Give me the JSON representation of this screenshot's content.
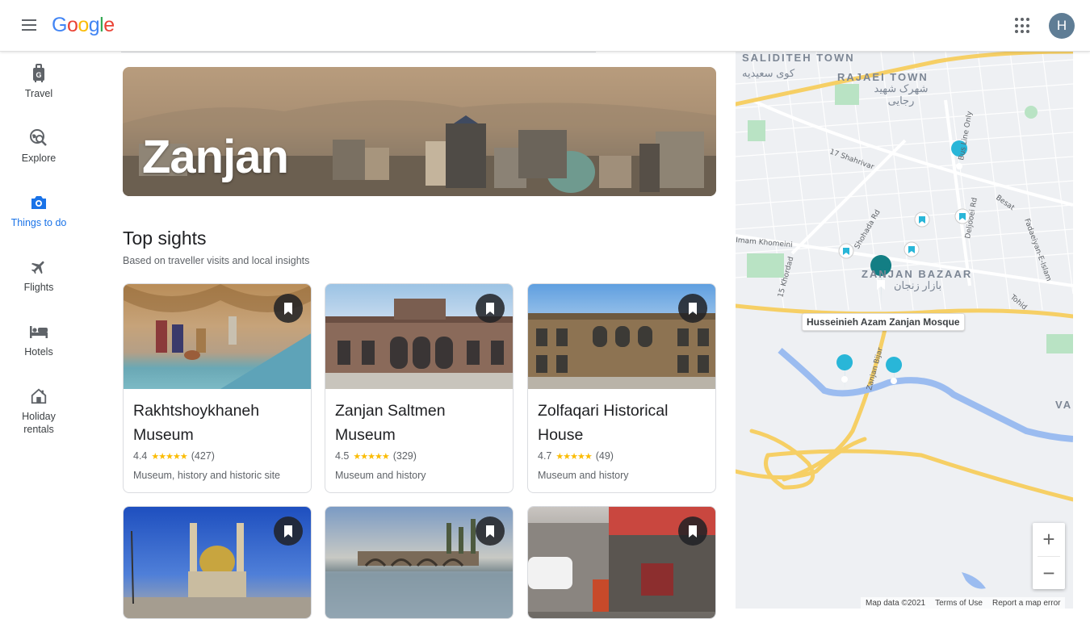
{
  "header": {
    "logo": "Google",
    "avatar_initial": "H"
  },
  "nav": [
    {
      "label": "Travel",
      "icon": "luggage-icon"
    },
    {
      "label": "Explore",
      "icon": "explore-icon"
    },
    {
      "label": "Things to do",
      "icon": "camera-icon",
      "active": true
    },
    {
      "label": "Flights",
      "icon": "plane-icon"
    },
    {
      "label": "Hotels",
      "icon": "bed-icon"
    },
    {
      "label": "Holiday rentals",
      "icon": "home-icon"
    }
  ],
  "hero": {
    "title": "Zanjan"
  },
  "section": {
    "title": "Top sights",
    "subtitle": "Based on traveller visits and local insights"
  },
  "cards": [
    {
      "name": "Rakhtshoykhaneh Museum",
      "rating": "4.4",
      "reviews": "(427)",
      "category": "Museum, history and historic site",
      "stars": 4.4
    },
    {
      "name": "Zanjan Saltmen Museum",
      "rating": "4.5",
      "reviews": "(329)",
      "category": "Museum and history",
      "stars": 4.5
    },
    {
      "name": "Zolfaqari Historical House",
      "rating": "4.7",
      "reviews": "(49)",
      "category": "Museum and history",
      "stars": 4.7
    }
  ],
  "map": {
    "labels": [
      "SALIDITEH TOWN",
      "RAJAEI TOWN",
      "ZANJAN BAZAAR",
      "VAH"
    ],
    "fa_labels": [
      "کوی سعیدیه",
      "شهرک شهید رجایی",
      "بازار زنجان"
    ],
    "streets": [
      "17 Shahrivar",
      "Shohada Rd",
      "Bus Line Only",
      "Besat",
      "Deljooei Rd",
      "Fadaeiyan-E-Islam",
      "Imam Khomeini",
      "15 Khordad",
      "Tohid",
      "Zanjan Bijar"
    ],
    "selected_place": "Husseinieh Azam Zanjan Mosque",
    "footer": {
      "data": "Map data ©2021",
      "terms": "Terms of Use",
      "report": "Report a map error"
    },
    "zoom_in": "+",
    "zoom_out": "−",
    "colors": {
      "road": "#f6cf65",
      "river": "#9bbcf0",
      "park": "#b9e3c4",
      "pin": "#29b6d8",
      "selected_pin": "#137e84"
    }
  }
}
